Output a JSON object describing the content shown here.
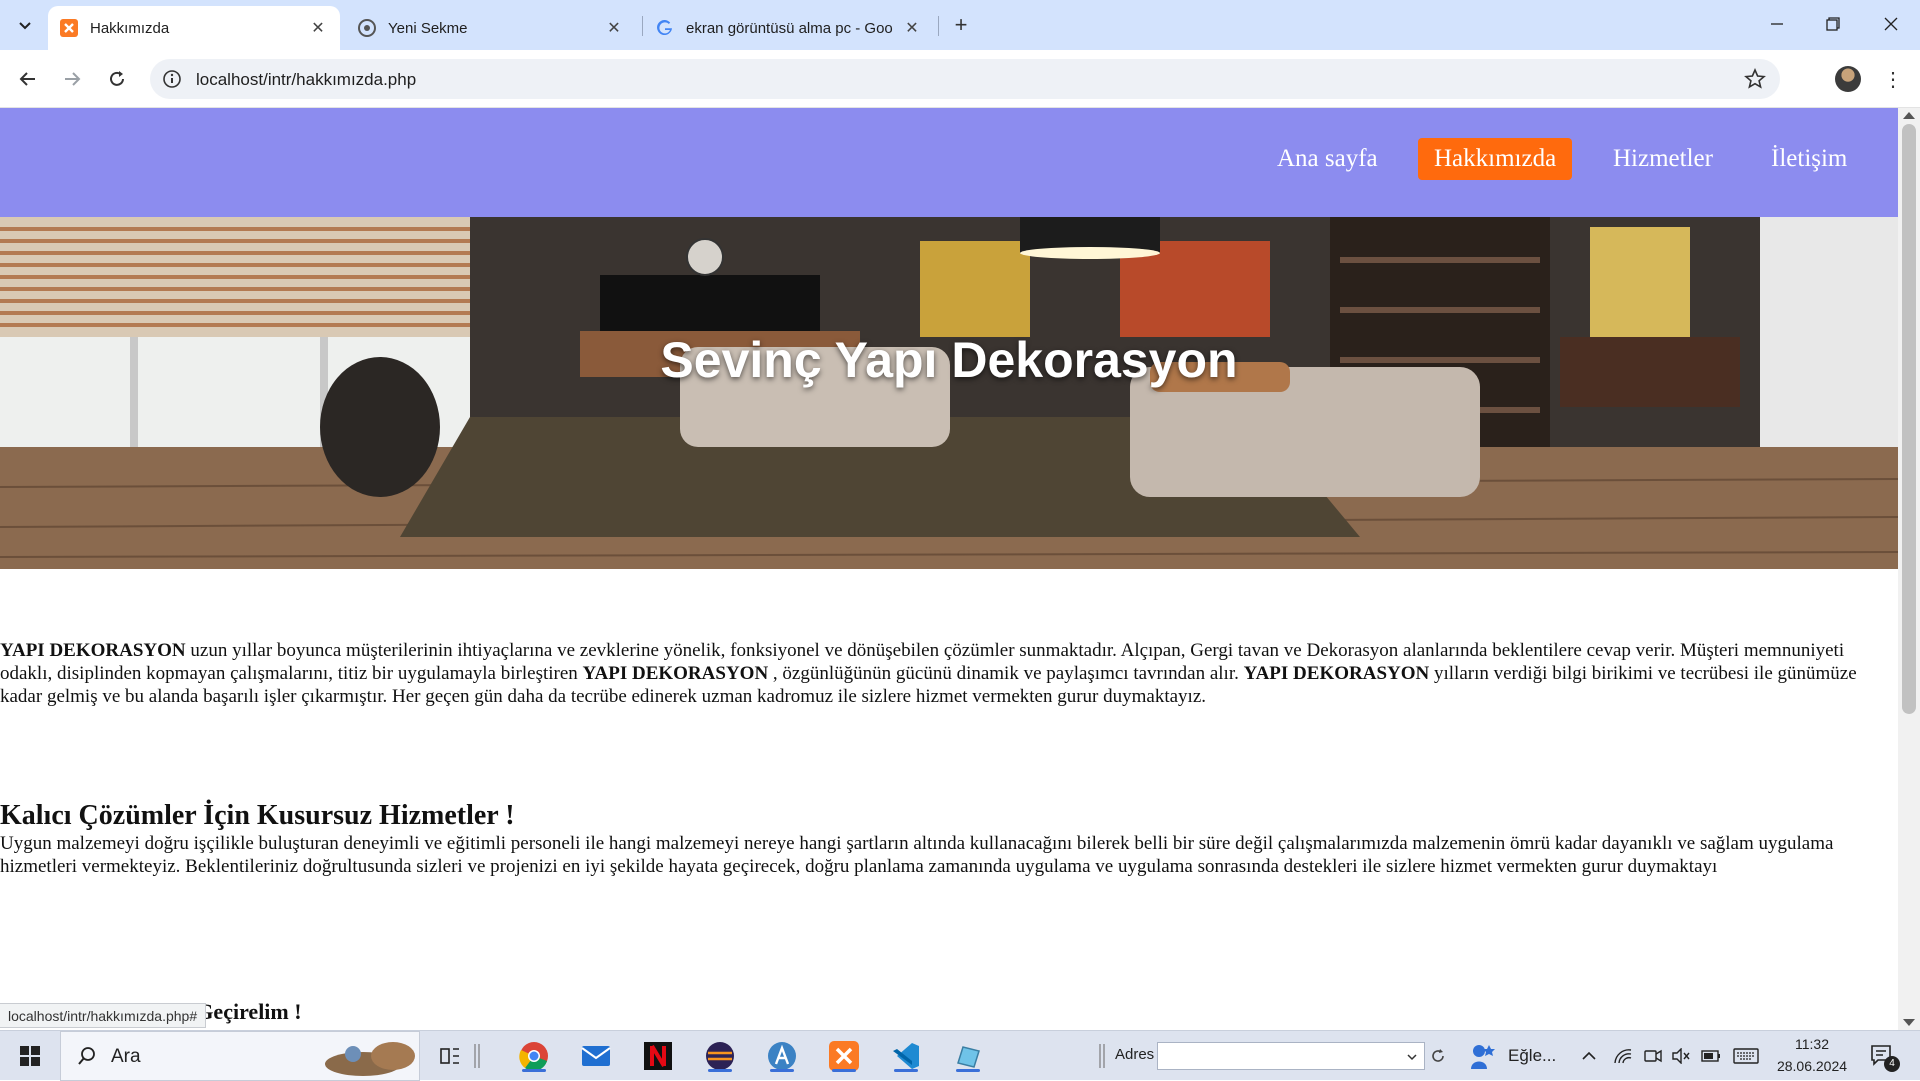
{
  "browser": {
    "tabs": [
      {
        "title": "Hakkımızda",
        "active": true
      },
      {
        "title": "Yeni Sekme",
        "active": false
      },
      {
        "title": "ekran görüntüsü alma pc - Goo",
        "active": false
      }
    ],
    "url": "localhost/intr/hakkımızda.php",
    "status_url": "localhost/intr/hakkımızda.php#"
  },
  "site": {
    "nav": [
      {
        "label": "Ana sayfa",
        "active": false
      },
      {
        "label": "Hakkımızda",
        "active": true
      },
      {
        "label": "Hizmetler",
        "active": false
      },
      {
        "label": "İletişim",
        "active": false
      }
    ],
    "hero_title": "Sevinç Yapı Dekorasyon",
    "intro": {
      "b1": "YAPI DEKORASYON",
      "t1": " uzun yıllar boyunca müşterilerinin ihtiyaçlarına ve zevklerine yönelik, fonksiyonel ve dönüşebilen çözümler sunmaktadır. Alçıpan, Gergi tavan ve Dekorasyon alanlarında beklentilere cevap verir. Müşteri memnuniyeti odaklı, disiplinden kopmayan çalışmalarını, titiz bir uygulamayla birleştiren ",
      "b2": "YAPI DEKORASYON",
      "t2": " , özgünlüğünün gücünü dinamik ve paylaşımcı tavrından alır. ",
      "b3": "YAPI DEKORASYON",
      "t3": " yılların verdiği bilgi birikimi ve tecrübesi ile günümüze kadar gelmiş ve bu alanda başarılı işler çıkarmıştır. Her geçen gün daha da tecrübe edinerek uzman kadromuz ile sizlere hizmet vermekten gurur duymaktayız."
    },
    "section1": {
      "heading": "Kalıcı Çözümler İçin Kusursuz Hizmetler !",
      "text": "Uygun malzemeyi doğru işçilikle buluşturan deneyimli ve eğitimli personeli ile hangi malzemeyi nereye hangi şartların altında kullanacağını bilerek belli bir süre değil çalışmalarımızda malzemenin ömrü kadar dayanıklı ve sağlam uygulama hizmetleri vermekteyiz. Beklentileriniz doğrultusunda sizleri ve projenizi en iyi şekilde hayata geçirecek, doğru planlama zamanında uygulama ve uygulama sonrasında destekleri ile sizlere hizmet vermekten gurur duymaktayı"
    },
    "section2": {
      "heading": "Projelerinizi Hayata Geçirelim !"
    }
  },
  "taskbar": {
    "search_label": "Ara",
    "address_label": "Adres",
    "weather_label": "Eğle...",
    "time": "11:32",
    "date": "28.06.2024",
    "notification_count": "4"
  },
  "colors": {
    "nav_bg": "#8c8cef",
    "nav_active": "#ff6a0d",
    "chrome_tabbar": "#d3e3fd"
  }
}
